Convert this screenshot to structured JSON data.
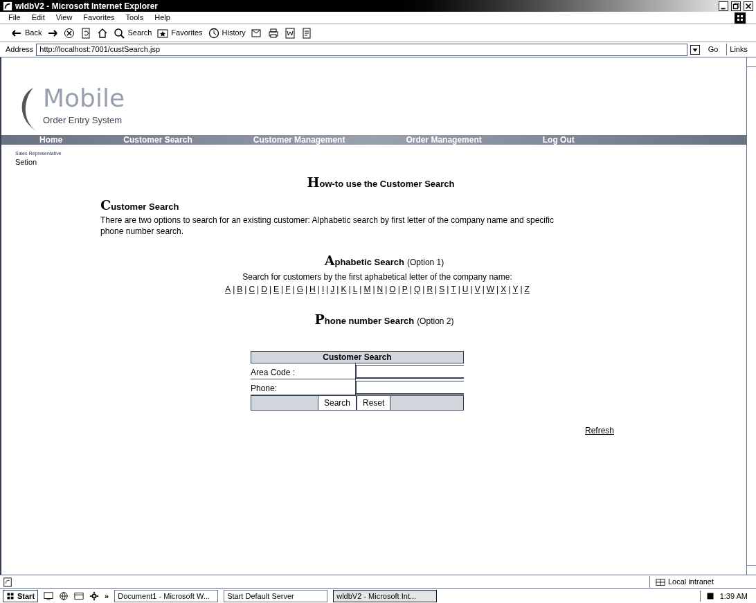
{
  "window": {
    "title": "wldbV2 - Microsoft Internet Explorer"
  },
  "menu": [
    "File",
    "Edit",
    "View",
    "Favorites",
    "Tools",
    "Help"
  ],
  "toolbar": [
    {
      "kind": "back",
      "label": "Back"
    },
    {
      "kind": "forward"
    },
    {
      "kind": "stop"
    },
    {
      "kind": "refresh"
    },
    {
      "kind": "home"
    },
    {
      "kind": "search",
      "label": "Search"
    },
    {
      "kind": "favorites",
      "label": "Favorites"
    },
    {
      "kind": "history",
      "label": "History"
    },
    {
      "kind": "mail"
    },
    {
      "kind": "print"
    },
    {
      "kind": "word"
    },
    {
      "kind": "edit"
    }
  ],
  "address_bar": {
    "label": "Address",
    "url": "http://localhost:7001/custSearch.jsp",
    "go": "Go",
    "links": "Links"
  },
  "page": {
    "logo_title": "Mobile",
    "logo_subtitle": "Order Entry System",
    "nav": [
      {
        "label": "Home"
      },
      {
        "label": "Customer Search"
      },
      {
        "label": "Customer Management"
      },
      {
        "label": "Order Management"
      },
      {
        "label": "Log Out"
      }
    ],
    "user_role": "Sales Representative",
    "user_name": "Setion",
    "title": "How-to use the Customer Search",
    "intro_heading": "Customer Search",
    "intro_text": "There are two options to search for an existing customer: Alphabetic search by first letter of the company name and specific phone number search.",
    "alpha_heading": "Aphabetic Search",
    "alpha_option": "(Option 1)",
    "alpha_text": "Search for customers by the first aphabetical letter of the company name:",
    "letters": [
      "A",
      "B",
      "C",
      "D",
      "E",
      "F",
      "G",
      "H",
      "I",
      "J",
      "K",
      "L",
      "M",
      "N",
      "O",
      "P",
      "Q",
      "R",
      "S",
      "T",
      "U",
      "V",
      "W",
      "X",
      "Y",
      "Z"
    ],
    "separator": "|",
    "phone_heading": "Phone number Search",
    "phone_option": "(Option 2)",
    "form": {
      "title": "Customer Search",
      "fields": [
        {
          "label": "Area Code :"
        },
        {
          "label": "Phone:"
        }
      ],
      "buttons": [
        "Search",
        "Reset"
      ]
    },
    "refresh": "Refresh"
  },
  "status_bar": {
    "zone": "Local intranet"
  },
  "taskbar": {
    "start": "Start",
    "more": "»",
    "tasks": [
      {
        "label": "Document1 - Microsoft W...",
        "selected": false
      },
      {
        "label": "Start Default Server",
        "selected": false
      },
      {
        "label": "wldbV2 - Microsoft Int...",
        "selected": true
      }
    ],
    "clock": "1:39 AM"
  }
}
